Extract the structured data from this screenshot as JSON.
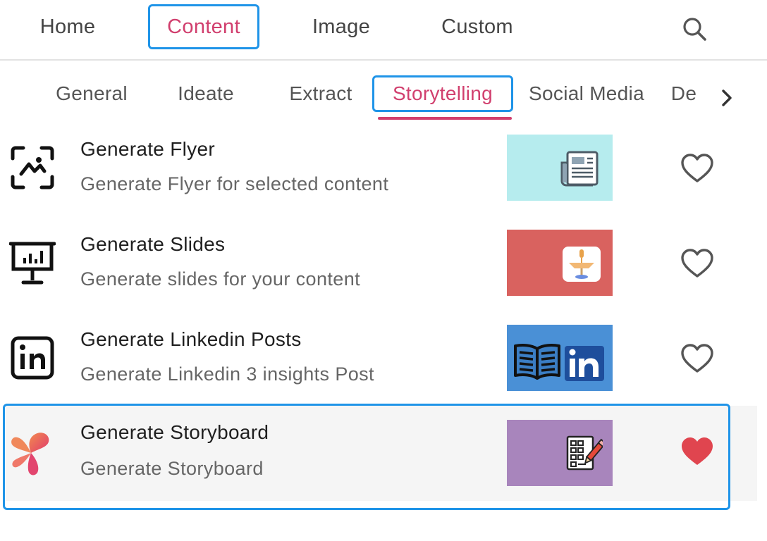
{
  "nav": {
    "tabs": [
      {
        "label": "Home",
        "active": false
      },
      {
        "label": "Content",
        "active": true
      },
      {
        "label": "Image",
        "active": false
      },
      {
        "label": "Custom",
        "active": false
      }
    ],
    "search_icon": "search-icon"
  },
  "subtabs": {
    "items": [
      {
        "label": "General",
        "active": false
      },
      {
        "label": "Ideate",
        "active": false
      },
      {
        "label": "Extract",
        "active": false
      },
      {
        "label": "Storytelling",
        "active": true
      },
      {
        "label": "Social Media",
        "active": false
      },
      {
        "label": "De",
        "active": false
      }
    ],
    "next_icon": "chevron-right-icon"
  },
  "items": [
    {
      "title": "Generate Flyer",
      "description": "Generate Flyer for selected content",
      "icon": "scan-image-icon",
      "thumb_icon": "newspaper-icon",
      "thumb_color": "#b6ecee",
      "favorite": false
    },
    {
      "title": "Generate Slides",
      "description": "Generate slides for your content",
      "icon": "presentation-chart-icon",
      "thumb_icon": "keynote-podium-icon",
      "thumb_color": "#d9625f",
      "favorite": false
    },
    {
      "title": "Generate Linkedin Posts",
      "description": "Generate Linkedin 3 insights Post",
      "icon": "linkedin-icon",
      "thumb_icon": "book-linkedin-icon",
      "thumb_color": "#4a90d6",
      "favorite": false
    },
    {
      "title": "Generate Storyboard",
      "description": "Generate Storyboard",
      "icon": "storyboard-logo-icon",
      "thumb_icon": "checklist-pencil-icon",
      "thumb_color": "#a885bc",
      "favorite": true,
      "selected": true
    }
  ],
  "colors": {
    "accent_pink": "#d13f6e",
    "focus_blue": "#1f94e8",
    "heart_red": "#e0454f"
  }
}
